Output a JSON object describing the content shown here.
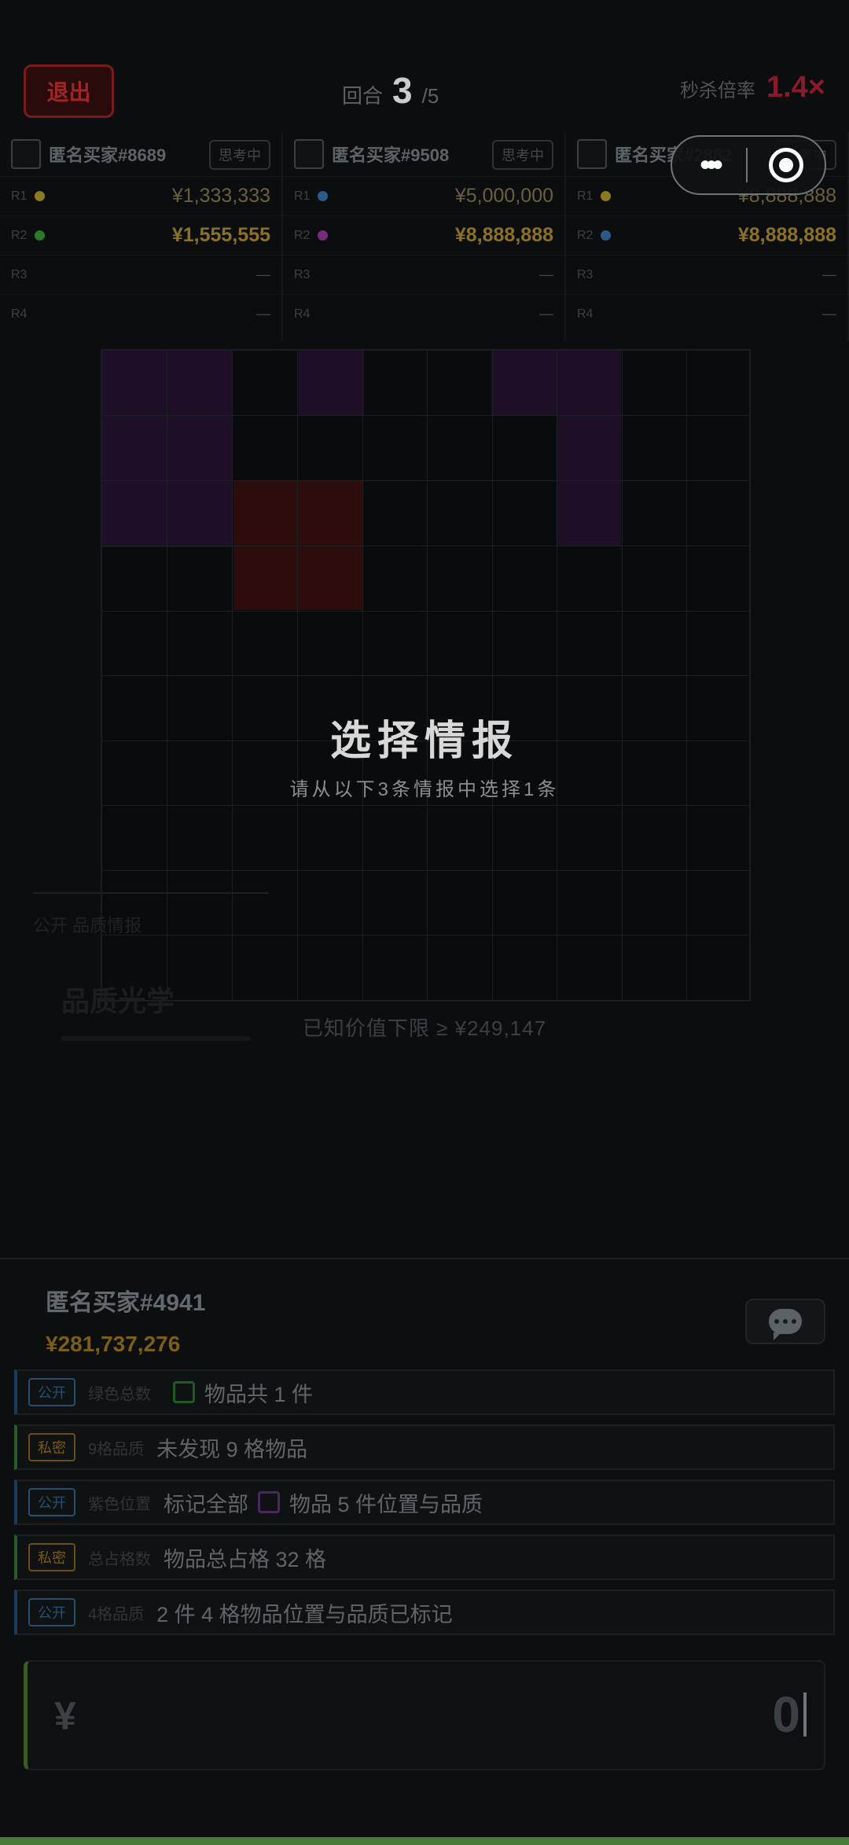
{
  "header": {
    "exit_label": "退出",
    "round_label": "回合",
    "round_current": "3",
    "round_total": "/5",
    "multiplier_label": "秒杀倍率",
    "multiplier_value": "1.4×"
  },
  "players": [
    {
      "name": "匿名买家#8689",
      "status": "思考中",
      "bids": [
        {
          "rank": "R1",
          "amount": "¥1,333,333",
          "dot": "#8a7a20"
        },
        {
          "rank": "R2",
          "amount": "¥1,555,555",
          "dot": "#2a7a2a"
        },
        {
          "rank": "R3",
          "amount": "—"
        },
        {
          "rank": "R4",
          "amount": "—"
        }
      ]
    },
    {
      "name": "匿名买家#9508",
      "status": "思考中",
      "bids": [
        {
          "rank": "R1",
          "amount": "¥5,000,000",
          "dot": "#2a5a8a"
        },
        {
          "rank": "R2",
          "amount": "¥8,888,888",
          "dot": "#7a2a7a"
        },
        {
          "rank": "R3",
          "amount": "—"
        },
        {
          "rank": "R4",
          "amount": "—"
        }
      ]
    },
    {
      "name": "匿名买家#2882",
      "status": "思考中",
      "bids": [
        {
          "rank": "R1",
          "amount": "¥8,888,888",
          "dot": "#8a7a20"
        },
        {
          "rank": "R2",
          "amount": "¥8,888,888",
          "dot": "#2a5a8a"
        },
        {
          "rank": "R3",
          "amount": "—"
        },
        {
          "rank": "R4",
          "amount": "—"
        }
      ]
    }
  ],
  "overlay": {
    "title": "选择情报",
    "subtitle": "请从以下3条情报中选择1条"
  },
  "faded_card": {
    "tag": "公开 品质情报",
    "title": "品质光学"
  },
  "known_floor": "已知价值下限 ≥ ¥249,147",
  "me": {
    "name": "匿名买家#4941",
    "money": "¥281,737,276"
  },
  "intel": [
    {
      "tag": "公开",
      "kind": "pub",
      "label": "绿色总数",
      "checkbox": "g",
      "text": "物品共 1 件",
      "prefix": ""
    },
    {
      "tag": "私密",
      "kind": "pri",
      "label": "9格品质",
      "checkbox": "",
      "text": "未发现 9 格物品",
      "prefix": ""
    },
    {
      "tag": "公开",
      "kind": "pub",
      "label": "紫色位置",
      "checkbox": "p",
      "text": "物品 5 件位置与品质",
      "prefix": "标记全部"
    },
    {
      "tag": "私密",
      "kind": "pri",
      "label": "总占格数",
      "checkbox": "",
      "text": "物品总占格 32 格",
      "prefix": ""
    },
    {
      "tag": "公开",
      "kind": "pub",
      "label": "4格品质",
      "checkbox": "",
      "text": "2 件 4 格物品位置与品质已标记",
      "prefix": ""
    }
  ],
  "price_input": {
    "currency": "¥",
    "value": "0"
  },
  "icons": {
    "more": "more-dots-icon",
    "target": "target-icon",
    "chat": "chat-icon"
  }
}
